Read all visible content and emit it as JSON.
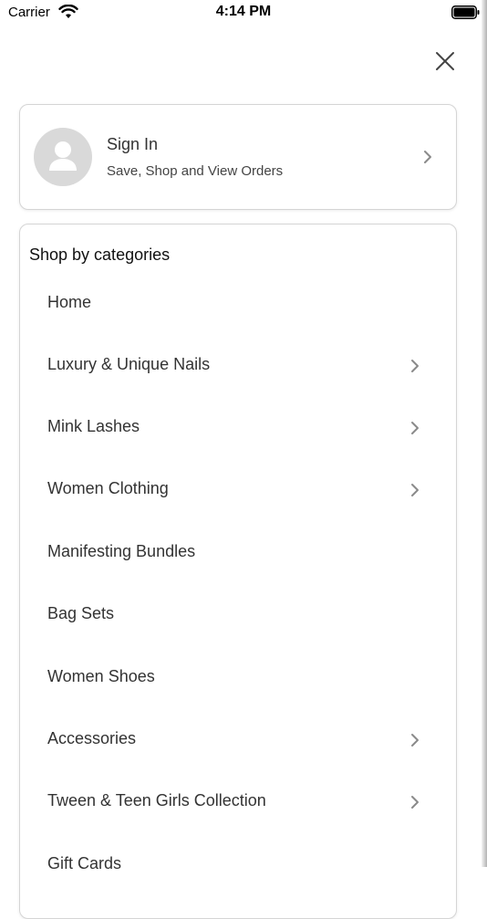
{
  "status_bar": {
    "carrier": "Carrier",
    "time": "4:14 PM"
  },
  "account": {
    "title": "Sign In",
    "subtitle": "Save, Shop and View Orders"
  },
  "categories": {
    "heading": "Shop by categories",
    "items": [
      {
        "label": "Home",
        "has_children": false
      },
      {
        "label": "Luxury & Unique Nails",
        "has_children": true
      },
      {
        "label": "Mink Lashes",
        "has_children": true
      },
      {
        "label": "Women Clothing",
        "has_children": true
      },
      {
        "label": "Manifesting Bundles",
        "has_children": false
      },
      {
        "label": "Bag Sets",
        "has_children": false
      },
      {
        "label": "Women Shoes",
        "has_children": false
      },
      {
        "label": "Accessories",
        "has_children": true
      },
      {
        "label": "Tween & Teen Girls Collection",
        "has_children": true
      },
      {
        "label": "Gift Cards",
        "has_children": false
      }
    ]
  },
  "icons": {
    "close": "close-icon",
    "avatar": "user-avatar-icon",
    "chevron": "chevron-right-icon"
  },
  "colors": {
    "avatar_bg": "#d9d9d9",
    "card_border": "#d5d5d5",
    "chevron": "#8a8a8a"
  }
}
